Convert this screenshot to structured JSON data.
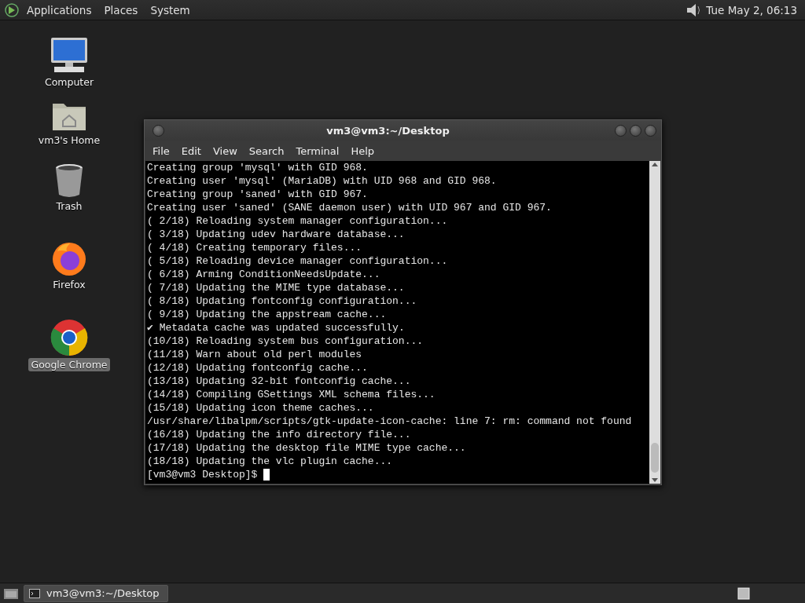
{
  "top_panel": {
    "menus": [
      "Applications",
      "Places",
      "System"
    ],
    "clock": "Tue May  2, 06:13"
  },
  "desktop_icons": [
    {
      "kind": "computer",
      "label": "Computer",
      "selected": false
    },
    {
      "kind": "home",
      "label": "vm3's Home",
      "selected": false
    },
    {
      "kind": "trash",
      "label": "Trash",
      "selected": false
    },
    {
      "kind": "firefox",
      "label": "Firefox",
      "selected": false
    },
    {
      "kind": "chrome",
      "label": "Google Chrome",
      "selected": true
    }
  ],
  "terminal": {
    "title": "vm3@vm3:~/Desktop",
    "menu": [
      "File",
      "Edit",
      "View",
      "Search",
      "Terminal",
      "Help"
    ],
    "lines": [
      "Creating group 'mysql' with GID 968.",
      "Creating user 'mysql' (MariaDB) with UID 968 and GID 968.",
      "Creating group 'saned' with GID 967.",
      "Creating user 'saned' (SANE daemon user) with UID 967 and GID 967.",
      "( 2/18) Reloading system manager configuration...",
      "( 3/18) Updating udev hardware database...",
      "( 4/18) Creating temporary files...",
      "( 5/18) Reloading device manager configuration...",
      "( 6/18) Arming ConditionNeedsUpdate...",
      "( 7/18) Updating the MIME type database...",
      "( 8/18) Updating fontconfig configuration...",
      "( 9/18) Updating the appstream cache...",
      "✔ Metadata cache was updated successfully.",
      "(10/18) Reloading system bus configuration...",
      "(11/18) Warn about old perl modules",
      "(12/18) Updating fontconfig cache...",
      "(13/18) Updating 32-bit fontconfig cache...",
      "(14/18) Compiling GSettings XML schema files...",
      "(15/18) Updating icon theme caches...",
      "/usr/share/libalpm/scripts/gtk-update-icon-cache: line 7: rm: command not found",
      "(16/18) Updating the info directory file...",
      "(17/18) Updating the desktop file MIME type cache...",
      "(18/18) Updating the vlc plugin cache..."
    ],
    "prompt": "[vm3@vm3 Desktop]$"
  },
  "taskbar": {
    "items": [
      {
        "label": "vm3@vm3:~/Desktop",
        "selected": true
      }
    ]
  }
}
